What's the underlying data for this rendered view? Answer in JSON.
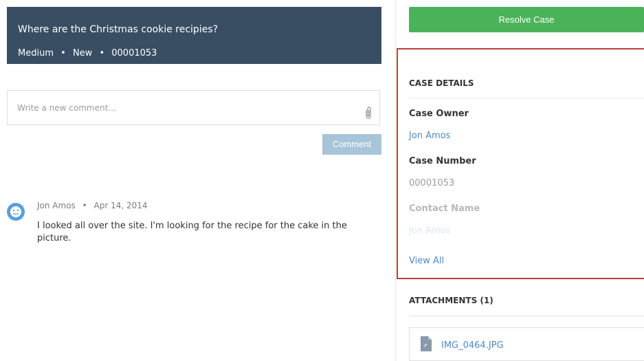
{
  "case": {
    "title": "Where are the Christmas cookie recipies?",
    "priority": "Medium",
    "separator": "•",
    "status": "New",
    "number": "00001053"
  },
  "comment": {
    "placeholder": "Write a new comment...",
    "button_label": "Comment"
  },
  "feed": {
    "author": "Jon Amos",
    "date": "Apr 14, 2014",
    "body": "I looked all over the site. I'm looking for the recipe for the cake in the picture."
  },
  "actions": {
    "resolve_label": "Resolve Case"
  },
  "details": {
    "title": "CASE DETAILS",
    "owner_label": "Case Owner",
    "owner_value": "Jon Amos",
    "number_label": "Case Number",
    "number_value": "00001053",
    "contact_label": "Contact Name",
    "contact_value": "Jon Amos",
    "view_all": "View All"
  },
  "attachments": {
    "title": "ATTACHMENTS (1)",
    "items": [
      {
        "name": "IMG_0464.JPG",
        "icon": "file-icon"
      }
    ]
  },
  "colors": {
    "header_bg": "#394e63",
    "resolve_green": "#4bb25a",
    "link_blue": "#4a89c9",
    "highlight_border": "#c23b3b",
    "comment_button": "#a7c4d8"
  }
}
